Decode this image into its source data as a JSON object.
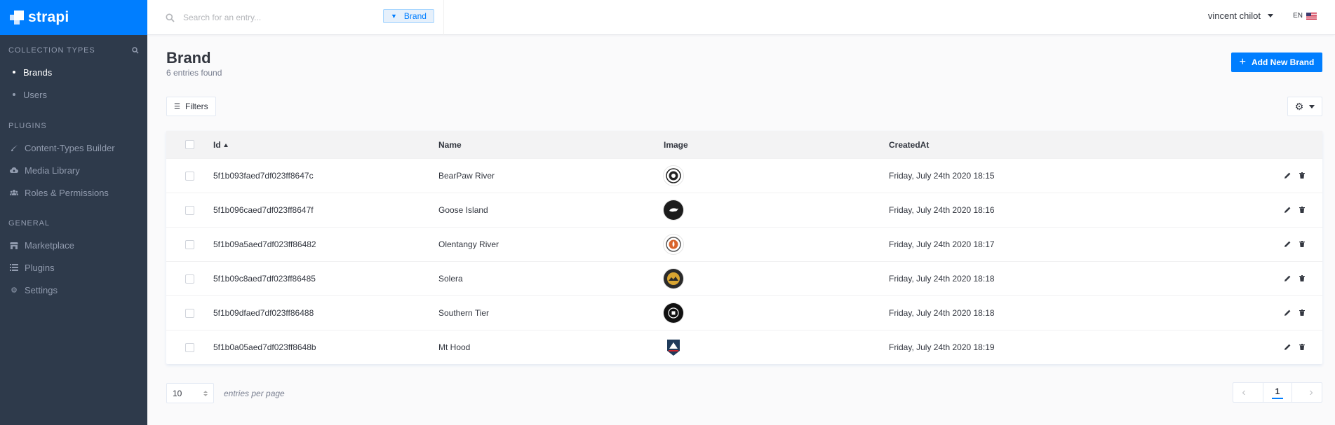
{
  "app": {
    "name": "strapi",
    "accent": "#007eff"
  },
  "sidebar": {
    "sections": [
      {
        "title": "Collection Types",
        "items": [
          {
            "label": "Brands",
            "active": true
          },
          {
            "label": "Users",
            "active": false
          }
        ]
      },
      {
        "title": "Plugins",
        "items": [
          {
            "label": "Content-Types Builder",
            "icon": "brush-icon"
          },
          {
            "label": "Media Library",
            "icon": "cloud-upload-icon"
          },
          {
            "label": "Roles & Permissions",
            "icon": "users-icon"
          }
        ]
      },
      {
        "title": "General",
        "items": [
          {
            "label": "Marketplace",
            "icon": "store-icon"
          },
          {
            "label": "Plugins",
            "icon": "list-icon"
          },
          {
            "label": "Settings",
            "icon": "gear-icon"
          }
        ]
      }
    ]
  },
  "header": {
    "search_placeholder": "Search for an entry...",
    "filter_tag": "Brand",
    "user_name": "vincent chilot",
    "language": "EN"
  },
  "page": {
    "title": "Brand",
    "subtitle": "6 entries found",
    "add_button": "Add New Brand",
    "filters_button": "Filters"
  },
  "table": {
    "columns": [
      "Id",
      "Name",
      "Image",
      "CreatedAt"
    ],
    "rows": [
      {
        "id": "5f1b093faed7df023ff8647c",
        "name": "BearPaw River",
        "created": "Friday, July 24th 2020 18:15"
      },
      {
        "id": "5f1b096caed7df023ff8647f",
        "name": "Goose Island",
        "created": "Friday, July 24th 2020 18:16"
      },
      {
        "id": "5f1b09a5aed7df023ff86482",
        "name": "Olentangy River",
        "created": "Friday, July 24th 2020 18:17"
      },
      {
        "id": "5f1b09c8aed7df023ff86485",
        "name": "Solera",
        "created": "Friday, July 24th 2020 18:18"
      },
      {
        "id": "5f1b09dfaed7df023ff86488",
        "name": "Southern Tier",
        "created": "Friday, July 24th 2020 18:18"
      },
      {
        "id": "5f1b0a05aed7df023ff8648b",
        "name": "Mt Hood",
        "created": "Friday, July 24th 2020 18:19"
      }
    ]
  },
  "footer": {
    "per_page": "10",
    "per_page_label": "entries per page",
    "current_page": "1"
  }
}
